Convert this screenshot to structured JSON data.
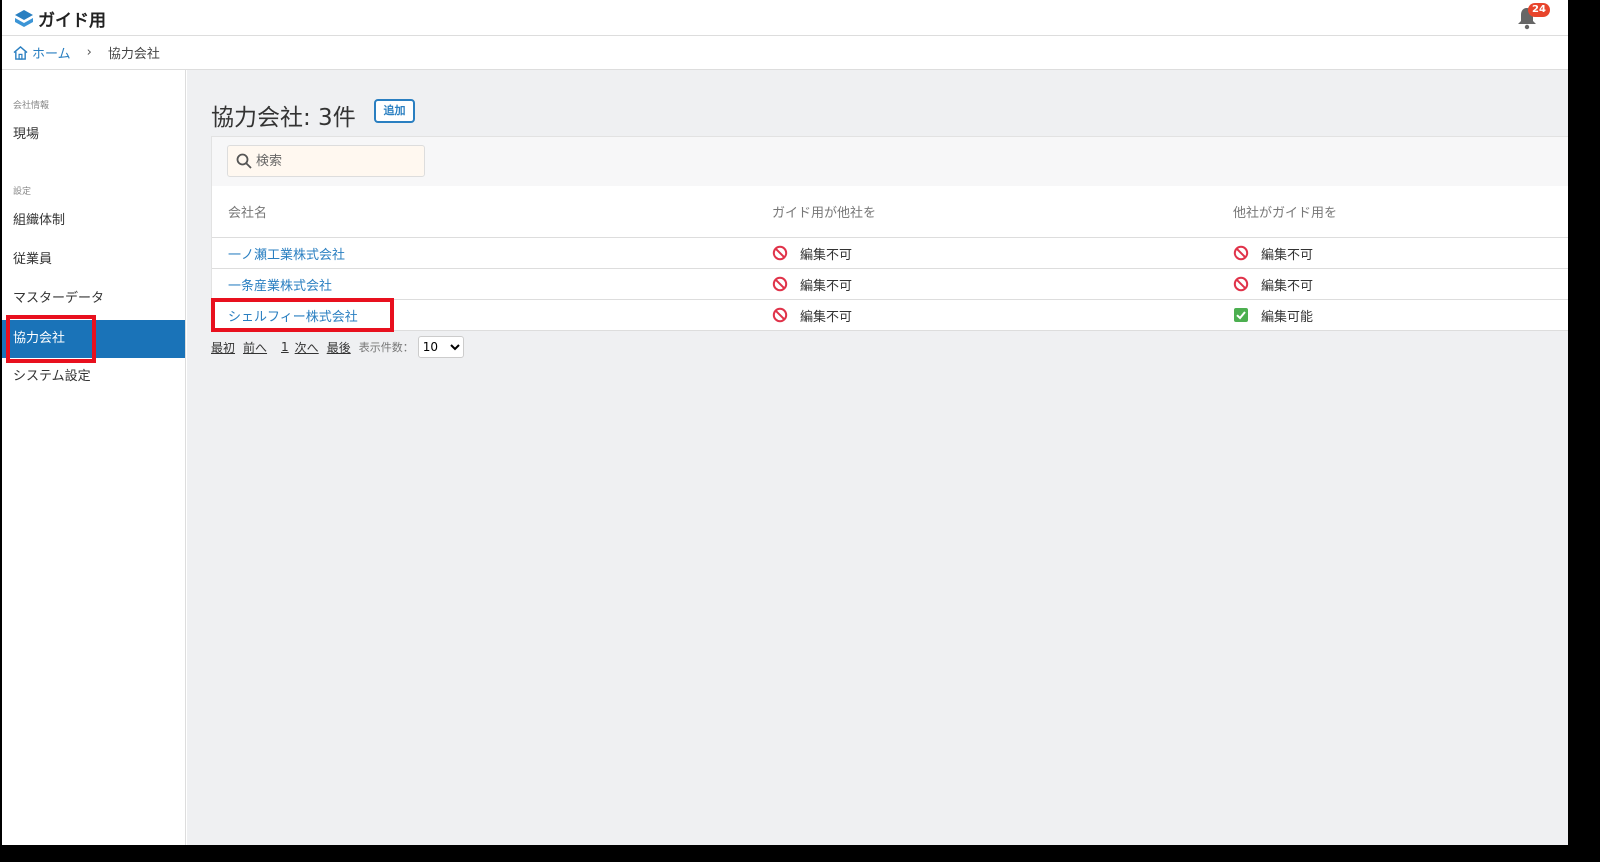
{
  "app": {
    "title": "ガイド用",
    "notification_count": "24"
  },
  "breadcrumb": {
    "home": "ホーム",
    "separator": "›",
    "current": "協力会社"
  },
  "sidebar": {
    "groups": [
      {
        "label": "会社情報",
        "items": [
          {
            "label": "現場"
          }
        ]
      },
      {
        "label": "設定",
        "items": [
          {
            "label": "組織体制"
          },
          {
            "label": "従業員"
          },
          {
            "label": "マスターデータ"
          },
          {
            "label": "協力会社",
            "active": true
          },
          {
            "label": "システム設定"
          }
        ]
      }
    ]
  },
  "main": {
    "title": "協力会社: 3件",
    "add_label": "追加",
    "search": {
      "placeholder": "検索",
      "value": ""
    },
    "table": {
      "headers": [
        "会社名",
        "ガイド用が他社を",
        "他社がガイド用を"
      ],
      "rows": [
        {
          "name": "一ノ瀬工業株式会社",
          "col2": {
            "icon": "prohibited-icon",
            "text": "編集不可"
          },
          "col3": {
            "icon": "prohibited-icon",
            "text": "編集不可"
          }
        },
        {
          "name": "一条産業株式会社",
          "col2": {
            "icon": "prohibited-icon",
            "text": "編集不可"
          },
          "col3": {
            "icon": "prohibited-icon",
            "text": "編集不可"
          }
        },
        {
          "name": "シェルフィー株式会社",
          "col2": {
            "icon": "prohibited-icon",
            "text": "編集不可"
          },
          "col3": {
            "icon": "check-icon",
            "text": "編集可能"
          }
        }
      ]
    },
    "pager": {
      "first": "最初",
      "prev": "前へ",
      "page": "1",
      "next": "次へ",
      "last": "最後",
      "per_page_label": "表示件数：",
      "per_page_value": "10"
    }
  },
  "colors": {
    "accent": "#1a73b8",
    "link": "#2a7fc1",
    "highlight": "#e8101e",
    "prohibited": "#e0334a",
    "check": "#4caf50"
  }
}
